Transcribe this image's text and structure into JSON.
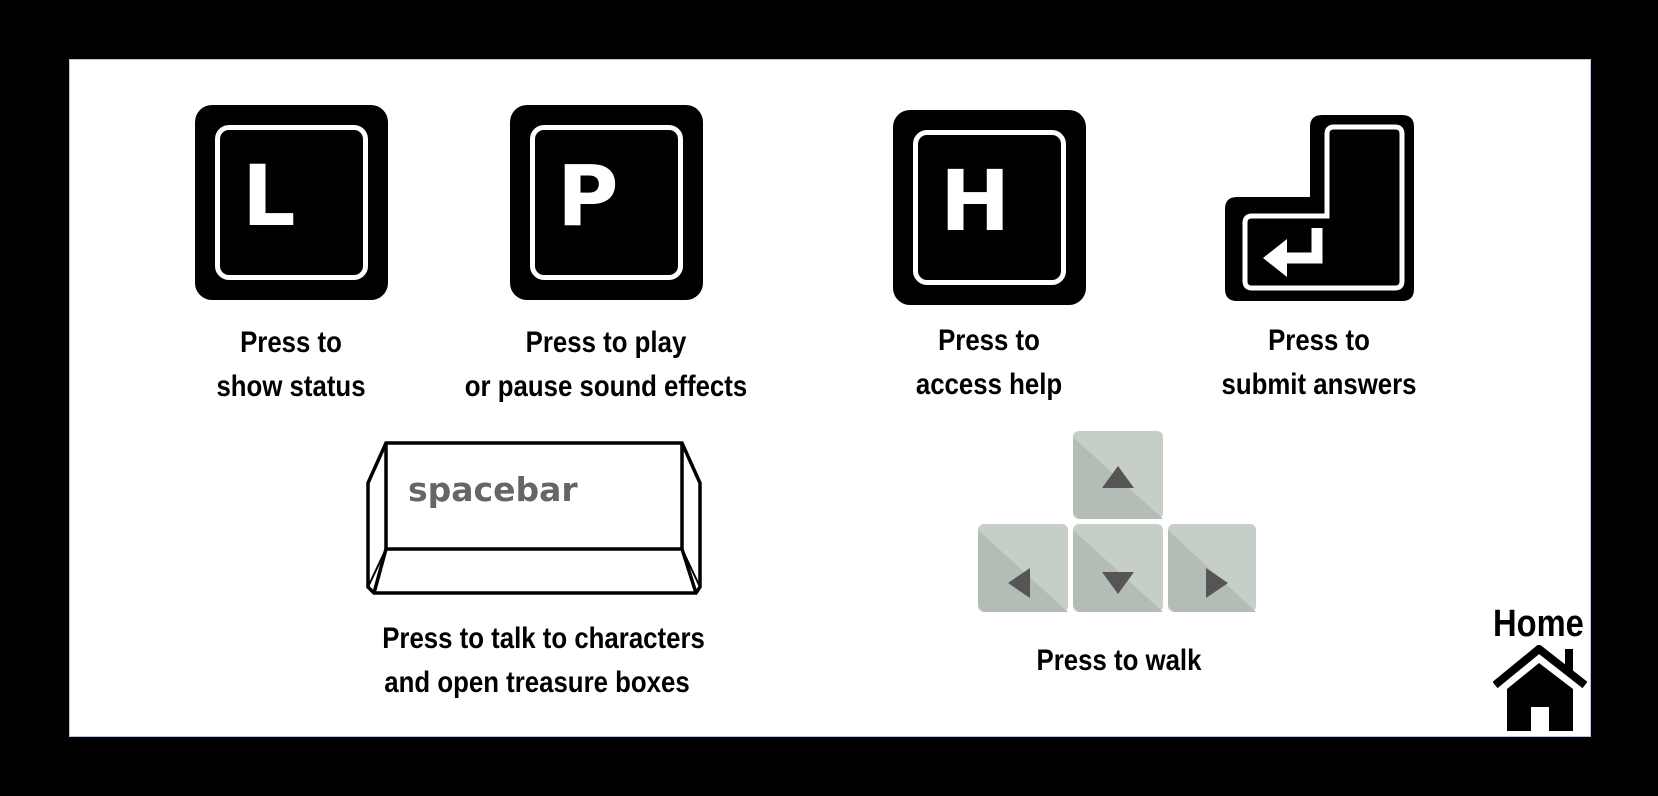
{
  "keys": {
    "l": {
      "letter": "L",
      "caption_line1": "Press to",
      "caption_line2": "show status"
    },
    "p": {
      "letter": "P",
      "caption_line1": "Press to play",
      "caption_line2": "or pause sound effects"
    },
    "h": {
      "letter": "H",
      "caption_line1": "Press to",
      "caption_line2": "access help"
    },
    "enter": {
      "icon": "enter-key-icon",
      "caption_line1": "Press to",
      "caption_line2": "submit answers"
    },
    "spacebar": {
      "label": "spacebar",
      "caption_line1": "Press to talk to characters",
      "caption_line2": "and open treasure boxes"
    },
    "arrows": {
      "icon": "arrow-keys-icon",
      "caption": "Press to walk"
    }
  },
  "home": {
    "label": "Home",
    "icon": "house-icon"
  },
  "colors": {
    "background": "#000000",
    "panel": "#ffffff",
    "key": "#000000",
    "arrow_key": "#c5cfc8",
    "arrow_glyph": "#555555",
    "spacebar_text": "#666666"
  }
}
